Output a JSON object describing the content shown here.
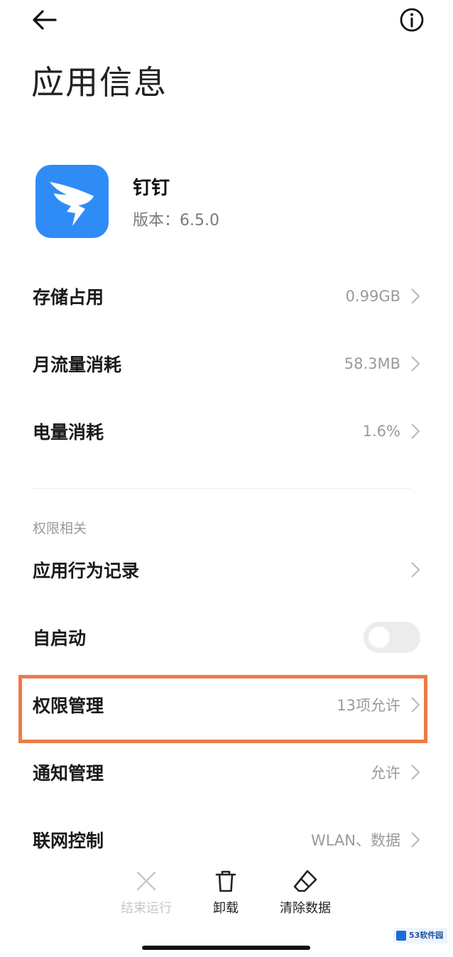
{
  "header": {
    "title": "应用信息"
  },
  "app": {
    "name": "钉钉",
    "version_label": "版本：",
    "version_value": "6.5.0"
  },
  "rows": [
    {
      "label": "存储占用",
      "value": "0.99GB"
    },
    {
      "label": "月流量消耗",
      "value": "58.3MB"
    },
    {
      "label": "电量消耗",
      "value": "1.6%"
    }
  ],
  "permissions": {
    "section_label": "权限相关",
    "items": [
      {
        "label": "应用行为记录",
        "value": ""
      },
      {
        "label": "自启动",
        "toggle_on": false
      },
      {
        "label": "权限管理",
        "value": "13项允许"
      },
      {
        "label": "通知管理",
        "value": "允许"
      },
      {
        "label": "联网控制",
        "value": "WLAN、数据"
      }
    ]
  },
  "bottom_actions": [
    {
      "label": "结束运行",
      "icon": "close-icon",
      "enabled": false
    },
    {
      "label": "卸载",
      "icon": "trash-icon",
      "enabled": true
    },
    {
      "label": "清除数据",
      "icon": "eraser-icon",
      "enabled": true
    }
  ],
  "watermark": {
    "text": "53软件园"
  },
  "colors": {
    "app_icon_bg": "#2f8cf6",
    "highlight_border": "#ee7a4a",
    "secondary_text": "#9a9a9a"
  }
}
